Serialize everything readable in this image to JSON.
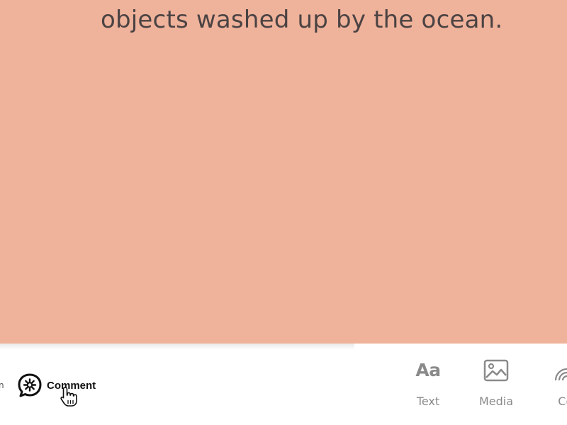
{
  "slide": {
    "text": "objects washed up by the ocean.",
    "background_color": "#efb29b"
  },
  "toolbar": {
    "cut_label": "n",
    "comment_label": "Comment",
    "tools": [
      {
        "label": "Text",
        "icon": "text-aa-icon"
      },
      {
        "label": "Media",
        "icon": "image-icon"
      },
      {
        "label": "Col",
        "icon": "rainbow-icon"
      }
    ]
  },
  "colors": {
    "slide_bg": "#efb29b",
    "slide_text": "#4b4343",
    "toolbar_bg": "#ffffff",
    "tool_gray": "#8a8a8a"
  }
}
